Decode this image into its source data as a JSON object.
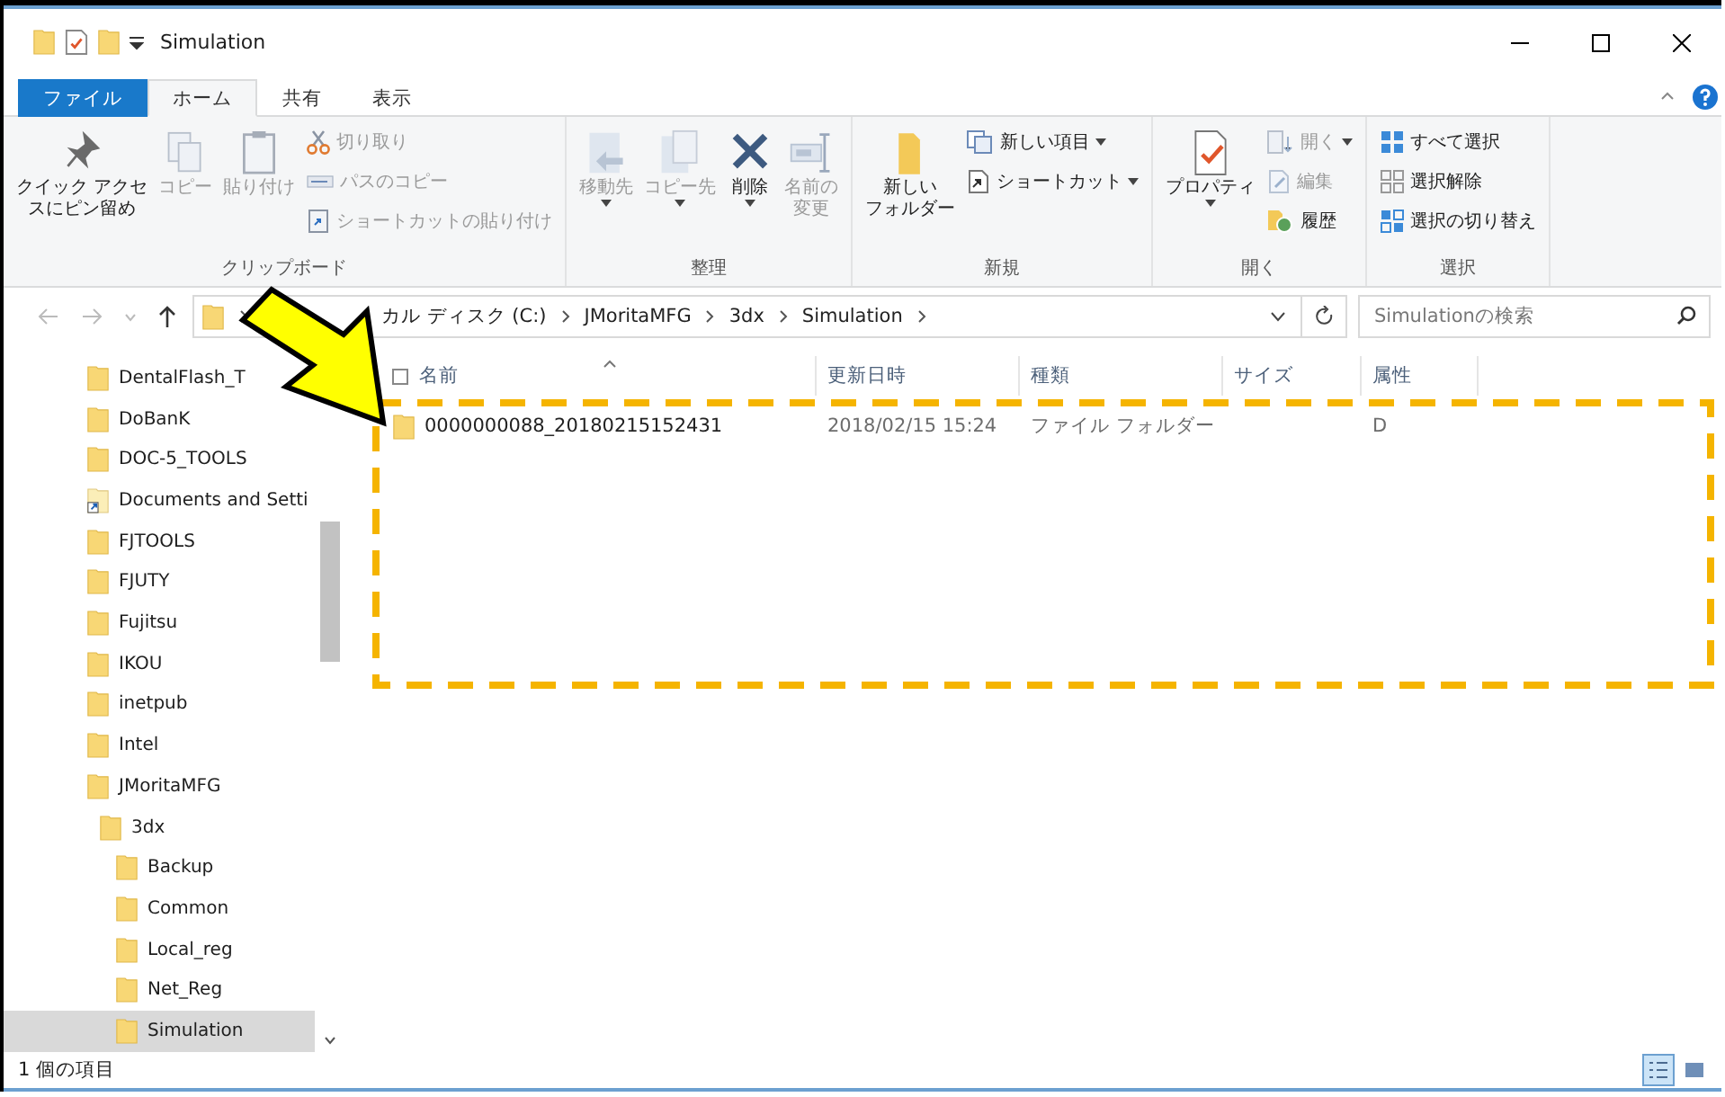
{
  "window": {
    "title": "Simulation"
  },
  "ribbon_tabs": [
    {
      "label": "ファイル",
      "kind": "file",
      "selected": false
    },
    {
      "label": "ホーム",
      "kind": "tab",
      "selected": true
    },
    {
      "label": "共有",
      "kind": "tab",
      "selected": false
    },
    {
      "label": "表示",
      "kind": "tab",
      "selected": false
    }
  ],
  "ribbon_groups": [
    {
      "label": "クリップボード",
      "buttons": [
        {
          "lines": [
            "クイック アクセ",
            "スにピン留め"
          ],
          "kind": "large",
          "disabled": false,
          "dropdown": false
        },
        {
          "lines": [
            "コピー"
          ],
          "kind": "large",
          "disabled": true,
          "dropdown": false
        },
        {
          "lines": [
            "貼り付け"
          ],
          "kind": "large",
          "disabled": true,
          "dropdown": false
        },
        {
          "lines": [
            "切り取り"
          ],
          "kind": "small",
          "disabled": true,
          "dropdown": false
        },
        {
          "lines": [
            "パスのコピー"
          ],
          "kind": "small",
          "disabled": true,
          "dropdown": false
        },
        {
          "lines": [
            "ショートカットの貼り付け"
          ],
          "kind": "small",
          "disabled": true,
          "dropdown": false
        }
      ]
    },
    {
      "label": "整理",
      "buttons": [
        {
          "lines": [
            "移動先"
          ],
          "kind": "large",
          "disabled": true,
          "dropdown": true
        },
        {
          "lines": [
            "コピー先"
          ],
          "kind": "large",
          "disabled": true,
          "dropdown": true
        },
        {
          "lines": [
            "削除"
          ],
          "kind": "large",
          "disabled": false,
          "dropdown": true
        },
        {
          "lines": [
            "名前の",
            "変更"
          ],
          "kind": "large",
          "disabled": true,
          "dropdown": false
        }
      ]
    },
    {
      "label": "新規",
      "buttons": [
        {
          "lines": [
            "新しい",
            "フォルダー"
          ],
          "kind": "large",
          "disabled": false,
          "dropdown": false
        },
        {
          "lines": [
            "新しい項目"
          ],
          "kind": "small",
          "disabled": false,
          "dropdown": true
        },
        {
          "lines": [
            "ショートカット"
          ],
          "kind": "small",
          "disabled": false,
          "dropdown": true
        }
      ]
    },
    {
      "label": "開く",
      "buttons": [
        {
          "lines": [
            "プロパティ"
          ],
          "kind": "large",
          "disabled": false,
          "dropdown": true
        },
        {
          "lines": [
            "開く"
          ],
          "kind": "small",
          "disabled": true,
          "dropdown": true
        },
        {
          "lines": [
            "編集"
          ],
          "kind": "small",
          "disabled": true,
          "dropdown": false
        },
        {
          "lines": [
            "履歴"
          ],
          "kind": "small",
          "disabled": false,
          "dropdown": false
        }
      ]
    },
    {
      "label": "選択",
      "buttons": [
        {
          "lines": [
            "すべて選択"
          ],
          "kind": "small",
          "disabled": false,
          "dropdown": false
        },
        {
          "lines": [
            "選択解除"
          ],
          "kind": "small",
          "disabled": false,
          "dropdown": false
        },
        {
          "lines": [
            "選択の切り替え"
          ],
          "kind": "small",
          "disabled": false,
          "dropdown": false
        }
      ]
    }
  ],
  "address_bar": {
    "crumbs": [
      "カル ディスク (C:)",
      "JMoritaMFG",
      "3dx",
      "Simulation"
    ]
  },
  "search": {
    "placeholder": "Simulationの検索"
  },
  "sidebar": {
    "items": [
      {
        "label": "DentalFlash_T",
        "kind": "folder",
        "selected": false
      },
      {
        "label": "DoBanK",
        "kind": "folder",
        "selected": false
      },
      {
        "label": "DOC-5_TOOLS",
        "kind": "folder",
        "selected": false
      },
      {
        "label": "Documents and Setti",
        "kind": "shortcut",
        "selected": false
      },
      {
        "label": "FJTOOLS",
        "kind": "folder",
        "selected": false
      },
      {
        "label": "FJUTY",
        "kind": "folder",
        "selected": false
      },
      {
        "label": "Fujitsu",
        "kind": "folder",
        "selected": false
      },
      {
        "label": "IKOU",
        "kind": "folder",
        "selected": false
      },
      {
        "label": "inetpub",
        "kind": "folder",
        "selected": false
      },
      {
        "label": "Intel",
        "kind": "folder",
        "selected": false
      },
      {
        "label": "JMoritaMFG",
        "kind": "folder",
        "selected": false,
        "children": [
          {
            "label": "3dx",
            "kind": "folder",
            "selected": false,
            "children": [
              {
                "label": "Backup",
                "kind": "folder",
                "selected": false
              },
              {
                "label": "Common",
                "kind": "folder",
                "selected": false
              },
              {
                "label": "Local_reg",
                "kind": "folder",
                "selected": false
              },
              {
                "label": "Net_Reg",
                "kind": "folder",
                "selected": false
              },
              {
                "label": "Simulation",
                "kind": "folder",
                "selected": true
              }
            ]
          }
        ]
      }
    ]
  },
  "file_list": {
    "columns": [
      "名前",
      "更新日時",
      "種類",
      "サイズ",
      "属性"
    ],
    "rows": [
      {
        "name": "0000000088_20180215152431",
        "modified": "2018/02/15 15:24",
        "type": "ファイル フォルダー",
        "attributes": "D"
      }
    ]
  },
  "status_bar": {
    "text": "1 個の項目",
    "views": [
      {
        "kind": "details",
        "selected": true
      },
      {
        "kind": "large_icons",
        "selected": false
      }
    ]
  }
}
